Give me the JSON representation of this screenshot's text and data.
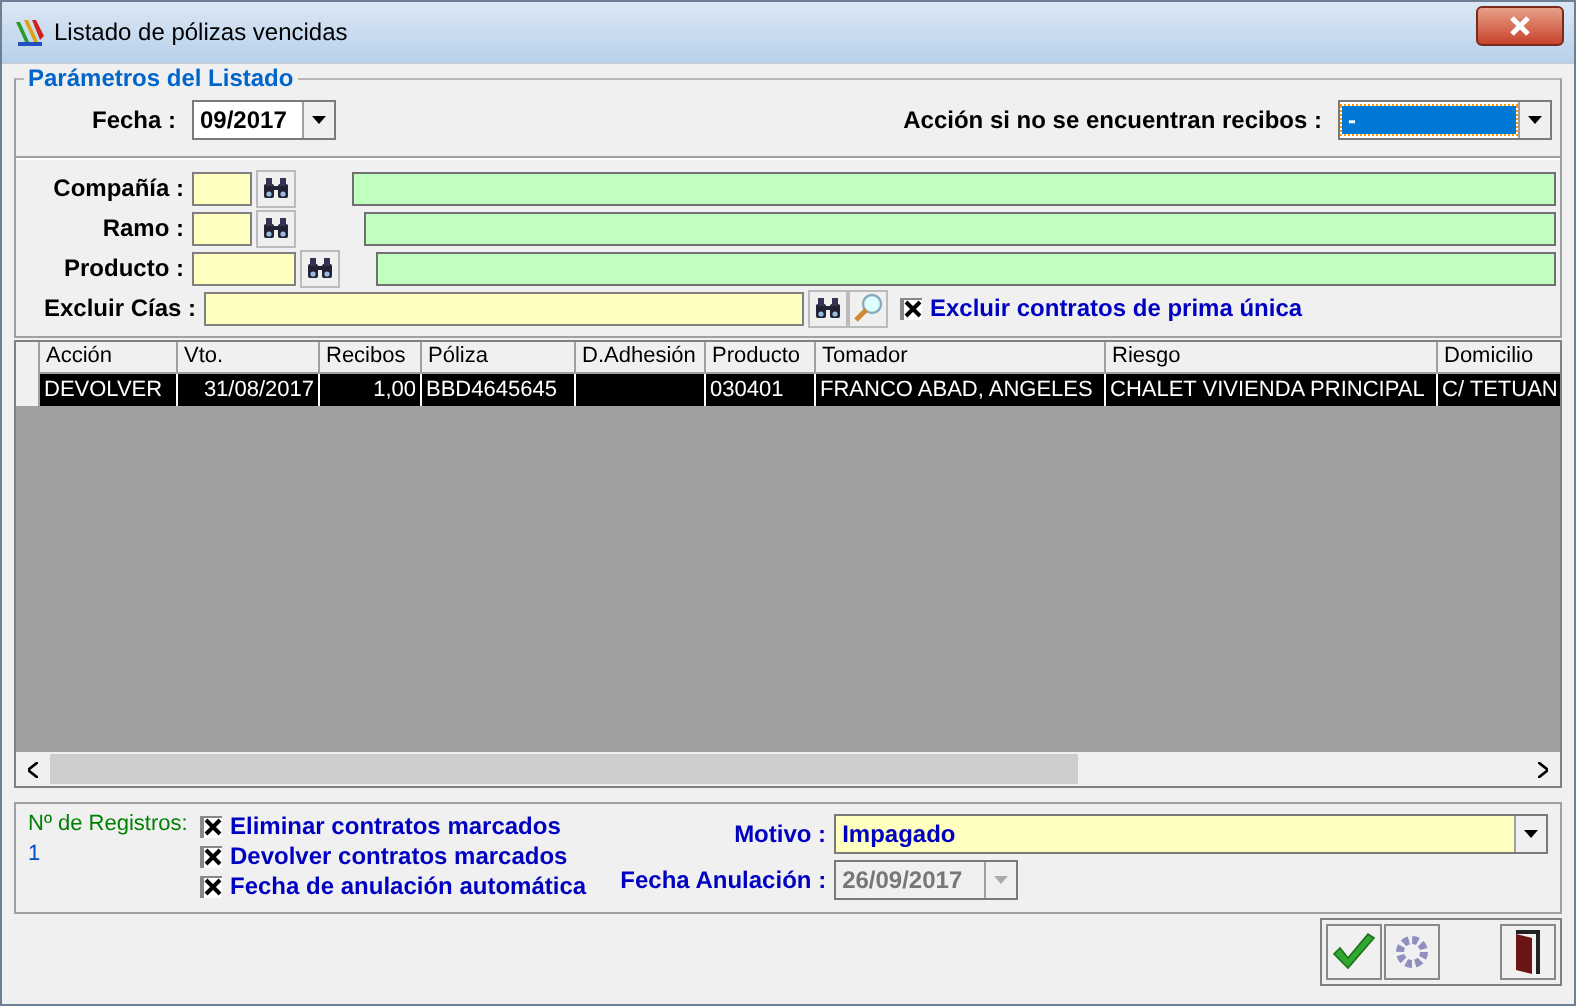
{
  "window": {
    "title": "Listado de pólizas vencidas"
  },
  "parameters": {
    "legend": "Parámetros del Listado",
    "fecha": {
      "label": "Fecha :",
      "value": "09/2017"
    },
    "accion": {
      "label": "Acción si no se encuentran recibos :",
      "value": "-"
    },
    "lookups": [
      {
        "label": "Compañía :"
      },
      {
        "label": "Ramo :"
      },
      {
        "label": "Producto :"
      }
    ],
    "excluir": {
      "label": "Excluir Cías :"
    },
    "prima_unica": {
      "label": "Excluir contratos de prima única",
      "checked": true
    }
  },
  "table": {
    "columns": [
      "Acción",
      "Vto.",
      "Recibos",
      "Póliza",
      "D.Adhesión",
      "Producto",
      "Tomador",
      "Riesgo",
      "Domicilio"
    ],
    "rows": [
      {
        "selected": true,
        "cells": [
          "DEVOLVER",
          "31/08/2017",
          "1,00",
          "BBD4645645",
          "",
          "030401",
          "FRANCO ABAD, ANGELES",
          "CHALET VIVIENDA PRINCIPAL",
          "C/ TETUAN"
        ]
      }
    ]
  },
  "footer": {
    "registros_label": "Nº de Registros:",
    "registros_count": "1",
    "options": [
      {
        "label": "Eliminar contratos marcados",
        "checked": true
      },
      {
        "label": "Devolver contratos marcados",
        "checked": true
      },
      {
        "label": "Fecha de anulación automática",
        "checked": true
      }
    ],
    "motivo": {
      "label": "Motivo :",
      "value": "Impagado"
    },
    "fecha_anulacion": {
      "label": "Fecha Anulación :",
      "value": "26/09/2017",
      "disabled": true
    }
  },
  "buttons": [
    {
      "kind": "accept"
    },
    {
      "kind": "settings"
    },
    {
      "kind": "exit"
    }
  ]
}
